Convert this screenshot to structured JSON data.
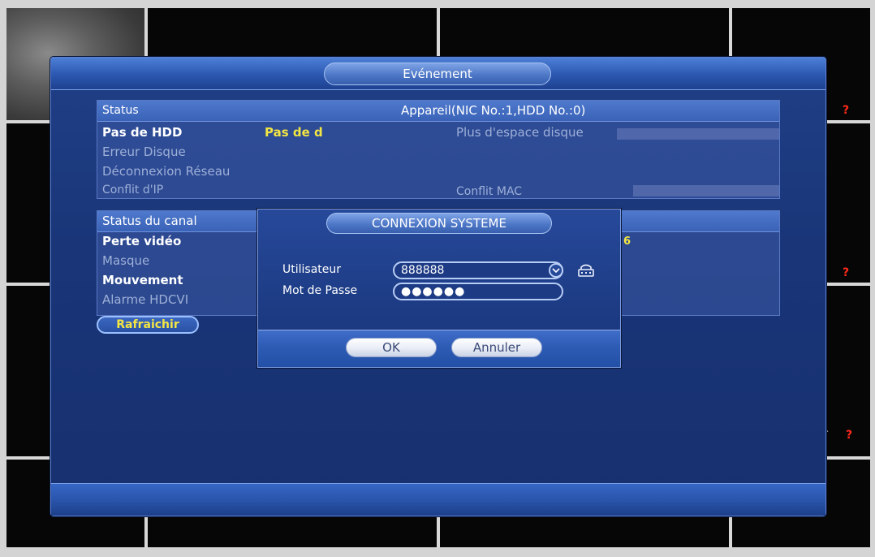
{
  "window": {
    "title": "Evénement"
  },
  "device_status": {
    "header_left": "Status",
    "header_right": "Appareil(NIC No.:1,HDD No.:0)",
    "rows": [
      {
        "label": "Pas de HDD",
        "value": "Pas de d",
        "extra": "Plus d'espace disque"
      },
      {
        "label": "Erreur Disque"
      },
      {
        "label": "Déconnexion Réseau"
      },
      {
        "label": "Conflit d'IP",
        "extra": "Conflit MAC"
      }
    ]
  },
  "channel_status": {
    "header": "Status du canal",
    "value_6": "6",
    "rows": [
      {
        "label": "Perte vidéo"
      },
      {
        "label": "Masque"
      },
      {
        "label": "Mouvement"
      },
      {
        "label": "Alarme HDCVI"
      }
    ],
    "refresh_label": "Rafraichir"
  },
  "login_dialog": {
    "title": "CONNEXION SYSTEME",
    "user_label": "Utilisateur",
    "user_value": "888888",
    "password_label": "Mot de Passe",
    "password_value": "●●●●●●",
    "ok_label": "OK",
    "cancel_label": "Annuler"
  },
  "grid_markers": {
    "symbol": "?",
    "color": "#ff2a1a"
  },
  "colors": {
    "accent_yellow": "#f3e642",
    "window_blue": "#1f3f86"
  }
}
